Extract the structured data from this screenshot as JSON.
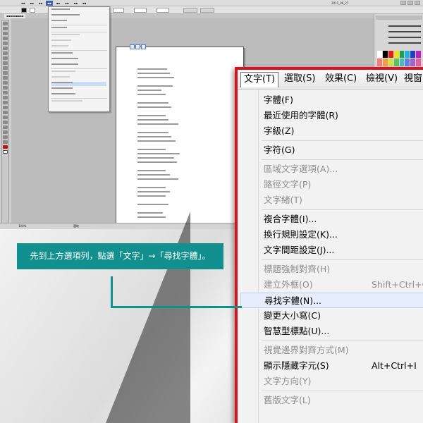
{
  "colors": {
    "frame_red": "#d8121e",
    "callout_teal": "#11908f",
    "menu_bg": "#f2f2f2",
    "text_enabled": "#000000",
    "text_disabled": "#8e8e8e"
  },
  "app": {
    "title_right": "2011_06_27",
    "zoom": "100%",
    "status": "選取"
  },
  "menubar": [
    {
      "label": "文字(T)",
      "active": true
    },
    {
      "label": "選取(S)",
      "active": false
    },
    {
      "label": "效果(C)",
      "active": false
    },
    {
      "label": "檢視(V)",
      "active": false
    },
    {
      "label": "視窗(",
      "active": false
    }
  ],
  "menu_items": [
    {
      "label": "字體(F)",
      "shortcut": "",
      "state": "enabled"
    },
    {
      "label": "最近使用的字體(R)",
      "shortcut": "",
      "state": "enabled"
    },
    {
      "label": "字級(Z)",
      "shortcut": "",
      "state": "enabled"
    },
    {
      "sep": true
    },
    {
      "label": "字符(G)",
      "shortcut": "",
      "state": "enabled"
    },
    {
      "sep": true
    },
    {
      "label": "區域文字選項(A)...",
      "shortcut": "",
      "state": "disabled"
    },
    {
      "label": "路徑文字(P)",
      "shortcut": "",
      "state": "disabled"
    },
    {
      "label": "文字緒(T)",
      "shortcut": "",
      "state": "disabled"
    },
    {
      "sep": true
    },
    {
      "label": "複合字體(I)...",
      "shortcut": "",
      "state": "enabled"
    },
    {
      "label": "換行規則設定(K)...",
      "shortcut": "",
      "state": "enabled"
    },
    {
      "label": "文字間距設定(J)...",
      "shortcut": "",
      "state": "enabled"
    },
    {
      "sep": true
    },
    {
      "label": "標題強制對齊(H)",
      "shortcut": "",
      "state": "disabled"
    },
    {
      "label": "建立外框(O)",
      "shortcut": "Shift+Ctrl+O",
      "state": "disabled"
    },
    {
      "label": "尋找字體(N)...",
      "shortcut": "",
      "state": "highlight"
    },
    {
      "label": "變更大小寫(C)",
      "shortcut": "",
      "state": "enabled"
    },
    {
      "label": "智慧型標點(U)...",
      "shortcut": "",
      "state": "enabled"
    },
    {
      "sep": true
    },
    {
      "label": "視覺邊界對齊方式(M)",
      "shortcut": "",
      "state": "disabled"
    },
    {
      "label": "顯示隱藏字元(S)",
      "shortcut": "Alt+Ctrl+I",
      "state": "enabled"
    },
    {
      "label": "文字方向(Y)",
      "shortcut": "",
      "state": "disabled"
    },
    {
      "sep": true
    },
    {
      "label": "舊版文字(L)",
      "shortcut": "",
      "state": "disabled"
    }
  ],
  "callout": {
    "text": "先到上方選項列，點選「文字」→「尋找字體」。"
  }
}
